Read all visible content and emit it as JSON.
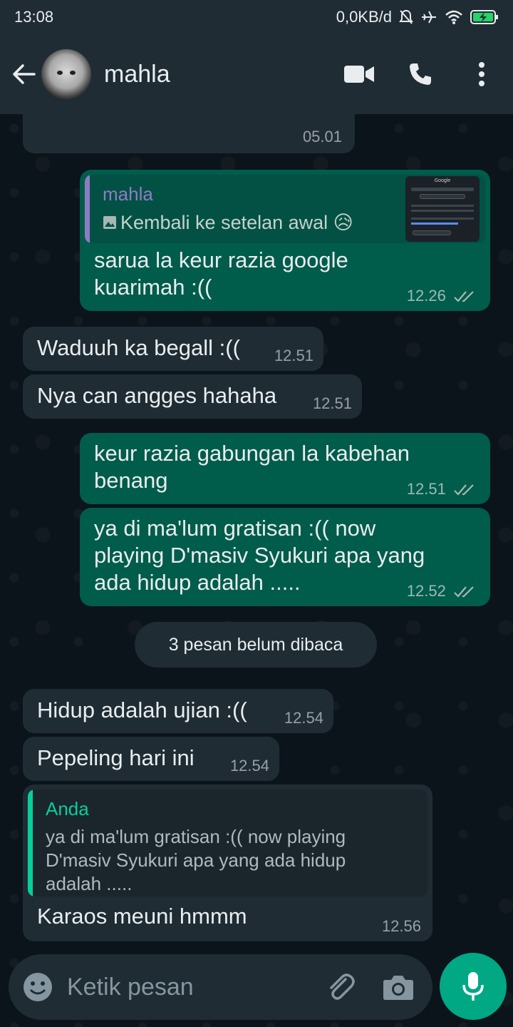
{
  "status_bar": {
    "time": "13:08",
    "net_speed": "0,0KB/d"
  },
  "header": {
    "contact_name": "mahla",
    "icons": [
      "back-arrow-icon",
      "video-call-icon",
      "phone-icon",
      "more-vert-icon"
    ]
  },
  "messages": [
    {
      "id": "m0",
      "direction": "in",
      "time": "05.01"
    },
    {
      "id": "m1",
      "direction": "out",
      "quote": {
        "author": "mahla",
        "text": "Kembali ke setelan awal 😥",
        "thumb_title": "Google"
      },
      "text_line1": "sarua la keur razia google",
      "text_line2": "kuarimah :((",
      "time": "12.26"
    },
    {
      "id": "m2",
      "direction": "in",
      "text": "Waduuh ka begall :((",
      "time": "12.51"
    },
    {
      "id": "m3",
      "direction": "in",
      "text": "Nya can angges hahaha",
      "time": "12.51"
    },
    {
      "id": "m4",
      "direction": "out",
      "text_line1": "keur razia gabungan la kabehan",
      "text_line2": "benang",
      "time": "12.51"
    },
    {
      "id": "m5",
      "direction": "out",
      "text_line1": "ya di ma'lum gratisan :(( now",
      "text_line2": "playing D'masiv Syukuri apa yang",
      "text_line3": "ada hidup adalah .....",
      "time": "12.52"
    },
    {
      "id": "m6",
      "direction": "in",
      "text": "Hidup adalah ujian :((",
      "time": "12.54"
    },
    {
      "id": "m7",
      "direction": "in",
      "text": "Pepeling hari ini",
      "time": "12.54"
    },
    {
      "id": "m8",
      "direction": "in",
      "quote": {
        "author": "Anda",
        "line1": "ya di ma'lum gratisan :(( now playing",
        "line2": "D'masiv Syukuri apa yang ada hidup",
        "line3": "adalah ....."
      },
      "text": "Karaos meuni hmmm",
      "time": "12.56"
    }
  ],
  "unread_divider": "3 pesan belum dibaca",
  "composer": {
    "placeholder": "Ketik pesan"
  },
  "colors": {
    "header_bg": "#1f2c34",
    "chat_bg": "#0b141a",
    "incoming_bubble": "#1f2c34",
    "outgoing_bubble": "#005c4b",
    "accent_green": "#00a884",
    "quote_purple": "#8e7cc3",
    "quote_green": "#06cf9c"
  }
}
